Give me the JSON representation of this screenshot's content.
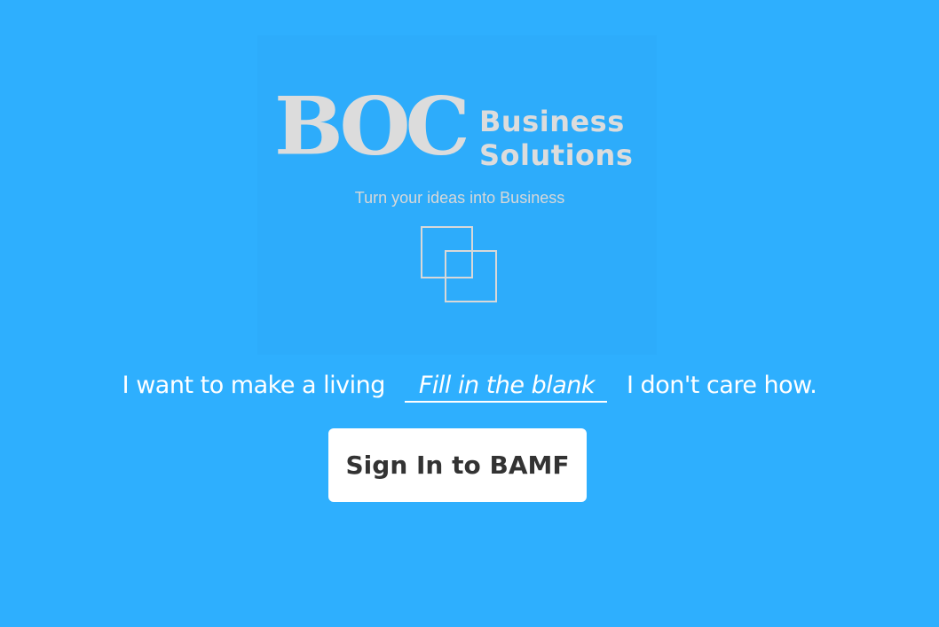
{
  "logo": {
    "letters": "BOC",
    "word1": "Business",
    "word2": "Solutions",
    "tagline": "Turn your ideas into Business"
  },
  "slogan": {
    "before": "I want to make a living",
    "blank": "Fill in the blank",
    "after": "I don't care how."
  },
  "signin": {
    "label": "Sign In to BAMF"
  },
  "colors": {
    "background": "#2eaffe",
    "logo_text": "#dcdcdc",
    "button_bg": "#ffffff",
    "button_text": "#333333"
  },
  "icons": {
    "logo_mark": "overlapping-squares-icon"
  }
}
